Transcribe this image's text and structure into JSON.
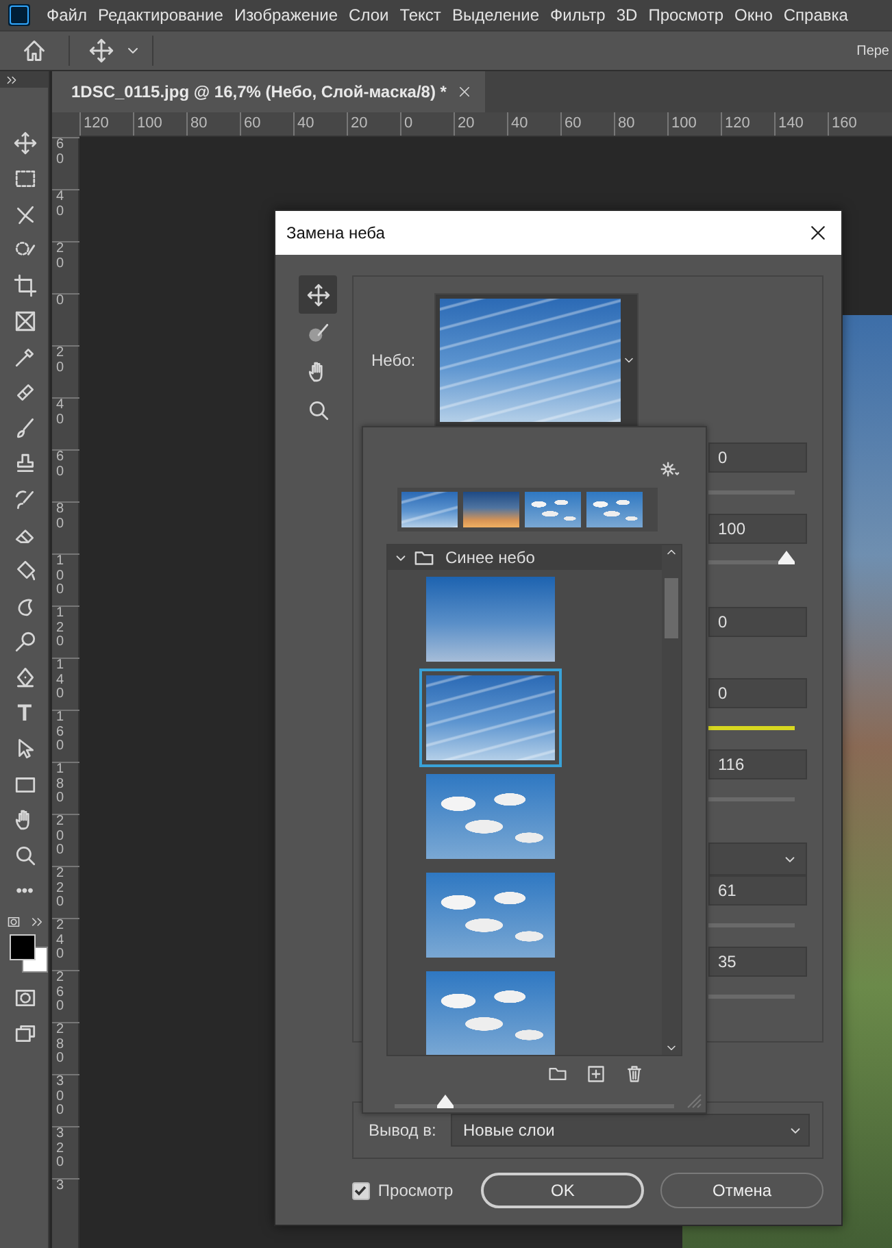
{
  "menu_bar": {
    "items": [
      "Файл",
      "Редактирование",
      "Изображение",
      "Слои",
      "Текст",
      "Выделение",
      "Фильтр",
      "3D",
      "Просмотр",
      "Окно",
      "Справка"
    ]
  },
  "options_bar": {
    "cut_label": "Пере"
  },
  "document_tab": {
    "title": "1DSC_0115.jpg @ 16,7% (Небо, Слой-маска/8) *"
  },
  "toolbar": {
    "tools": [
      {
        "kind": "move"
      },
      {
        "kind": "marquee"
      },
      {
        "kind": "lasso"
      },
      {
        "kind": "quick-select"
      },
      {
        "kind": "crop"
      },
      {
        "kind": "frame"
      },
      {
        "kind": "eyedropper"
      },
      {
        "kind": "bandage"
      },
      {
        "kind": "brush"
      },
      {
        "kind": "stamp"
      },
      {
        "kind": "history-brush"
      },
      {
        "kind": "eraser"
      },
      {
        "kind": "bucket"
      },
      {
        "kind": "smudge"
      },
      {
        "kind": "dodge"
      },
      {
        "kind": "pen"
      },
      {
        "kind": "type",
        "glyph": "T"
      },
      {
        "kind": "arrow"
      },
      {
        "kind": "rectangle"
      },
      {
        "kind": "hand"
      },
      {
        "kind": "zoom"
      },
      {
        "kind": "more",
        "glyph": "•••"
      },
      {
        "kind": "colors"
      },
      {
        "kind": "quick-mask"
      },
      {
        "kind": "screen-mode"
      }
    ]
  },
  "ruler_horizontal": {
    "labels": [
      "120",
      "100",
      "80",
      "60",
      "40",
      "20",
      "0",
      "20",
      "40",
      "60",
      "80",
      "100",
      "120",
      "140",
      "160"
    ]
  },
  "ruler_vertical": {
    "labels": [
      "60",
      "40",
      "20",
      "0",
      "20",
      "40",
      "60",
      "80",
      "100",
      "120",
      "140",
      "160",
      "180",
      "200",
      "220",
      "240",
      "260",
      "280",
      "300",
      "320",
      "3"
    ]
  },
  "dialog": {
    "title": "Замена неба",
    "tools": [
      {
        "kind": "move",
        "selected": true
      },
      {
        "kind": "sky-brush",
        "selected": false
      },
      {
        "kind": "hand",
        "selected": false
      },
      {
        "kind": "zoom",
        "selected": false
      }
    ],
    "sky": {
      "label": "Небо:",
      "kind": "wispy"
    },
    "settings": [
      {
        "items": [
          {
            "kind": "field",
            "value": "0"
          },
          {
            "kind": "track"
          },
          {
            "kind": "field",
            "value": "100"
          },
          {
            "kind": "slider",
            "level": 1
          }
        ]
      },
      {
        "items": [
          {
            "kind": "field",
            "value": "0"
          }
        ]
      },
      {
        "items": [
          {
            "kind": "field",
            "value": "0"
          },
          {
            "kind": "track",
            "color": "#d8d820"
          },
          {
            "kind": "field",
            "value": "116"
          },
          {
            "kind": "track"
          }
        ]
      },
      {
        "items": [
          {
            "kind": "dropdown"
          },
          {
            "kind": "field",
            "value": "61"
          },
          {
            "kind": "track"
          },
          {
            "kind": "field",
            "value": "35"
          },
          {
            "kind": "track"
          }
        ]
      }
    ],
    "output": {
      "label": "Вывод в:",
      "value": "Новые слои"
    },
    "preview": {
      "label": "Просмотр",
      "checked": true
    },
    "buttons": [
      {
        "label": "OK",
        "default": true
      },
      {
        "label": "Отмена",
        "default": false
      }
    ]
  },
  "sky_picker": {
    "recent": [
      {
        "kind": "wispy"
      },
      {
        "kind": "sunset"
      },
      {
        "kind": "cumulus"
      },
      {
        "kind": "cumulus"
      }
    ],
    "folder": {
      "name": "Синее небо",
      "expanded": true,
      "skies": [
        {
          "kind": "clear",
          "selected": false
        },
        {
          "kind": "wispy",
          "selected": true
        },
        {
          "kind": "cumulus",
          "selected": false
        },
        {
          "kind": "cumulus",
          "selected": false
        },
        {
          "kind": "cumulus",
          "selected": false
        }
      ]
    },
    "size_slider": {
      "level": 0.16
    }
  }
}
